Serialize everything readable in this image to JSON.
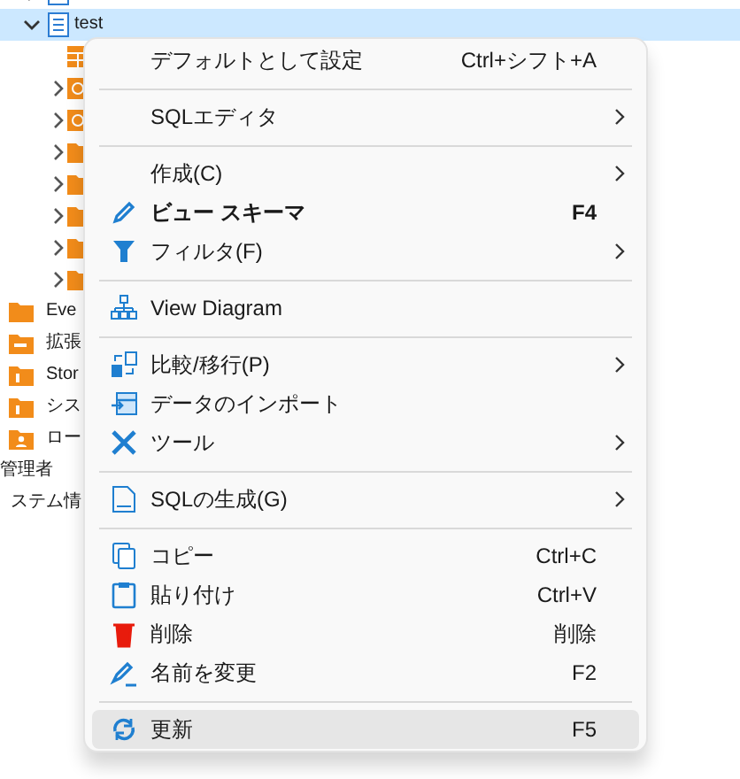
{
  "tree": {
    "schemas": [
      {
        "selected": false
      },
      {
        "label": "test",
        "expanded": true,
        "selected": true,
        "children": [
          {
            "kind": "table",
            "expandable": false
          },
          {
            "kind": "view",
            "expandable": true
          },
          {
            "kind": "view",
            "expandable": true
          },
          {
            "kind": "folder",
            "expandable": true
          },
          {
            "kind": "folder",
            "expandable": true
          },
          {
            "kind": "folder",
            "expandable": true
          },
          {
            "kind": "folder",
            "expandable": true
          },
          {
            "kind": "folder",
            "expandable": true
          }
        ]
      }
    ],
    "objects": [
      {
        "kind": "folder",
        "label": "Eve"
      },
      {
        "kind": "extension",
        "label": "拡張"
      },
      {
        "kind": "info",
        "label": "Stor"
      },
      {
        "kind": "info",
        "label": "シス"
      },
      {
        "kind": "role",
        "label": "ロー"
      }
    ],
    "nodes": [
      {
        "label": "管理者"
      },
      {
        "label": "ステム情"
      }
    ]
  },
  "context_menu": {
    "items": [
      {
        "kind": "item",
        "label": "デフォルトとして設定",
        "shortcut": "Ctrl+シフト+A",
        "submenu": false,
        "bold": false,
        "hovered": false
      },
      {
        "kind": "separator"
      },
      {
        "kind": "item",
        "label": "SQLエディタ",
        "submenu": true,
        "bold": false,
        "hovered": false
      },
      {
        "kind": "separator"
      },
      {
        "kind": "item",
        "label": "作成(C)",
        "submenu": true,
        "bold": false,
        "hovered": false
      },
      {
        "kind": "item",
        "label": "ビュー スキーマ",
        "shortcut": "F4",
        "submenu": false,
        "bold": true,
        "hovered": false
      },
      {
        "kind": "item",
        "label": "フィルタ(F)",
        "submenu": true,
        "bold": false,
        "hovered": false
      },
      {
        "kind": "separator"
      },
      {
        "kind": "item",
        "label": "View Diagram",
        "submenu": false,
        "bold": false,
        "hovered": false
      },
      {
        "kind": "separator"
      },
      {
        "kind": "item",
        "label": "比較/移行(P)",
        "submenu": true,
        "bold": false,
        "hovered": false
      },
      {
        "kind": "item",
        "label": "データのインポート",
        "submenu": false,
        "bold": false,
        "hovered": false
      },
      {
        "kind": "item",
        "label": "ツール",
        "submenu": true,
        "bold": false,
        "hovered": false
      },
      {
        "kind": "separator"
      },
      {
        "kind": "item",
        "label": "SQLの生成(G)",
        "submenu": true,
        "bold": false,
        "hovered": false
      },
      {
        "kind": "separator"
      },
      {
        "kind": "item",
        "label": "コピー",
        "shortcut": "Ctrl+C",
        "submenu": false,
        "bold": false,
        "hovered": false
      },
      {
        "kind": "item",
        "label": "貼り付け",
        "shortcut": "Ctrl+V",
        "submenu": false,
        "bold": false,
        "hovered": false
      },
      {
        "kind": "item",
        "label": "削除",
        "shortcut": "削除",
        "submenu": false,
        "bold": false,
        "hovered": false
      },
      {
        "kind": "item",
        "label": "名前を変更",
        "shortcut": "F2",
        "submenu": false,
        "bold": false,
        "hovered": false
      },
      {
        "kind": "separator"
      },
      {
        "kind": "item",
        "label": "更新",
        "shortcut": "F5",
        "submenu": false,
        "bold": false,
        "hovered": true
      }
    ]
  }
}
